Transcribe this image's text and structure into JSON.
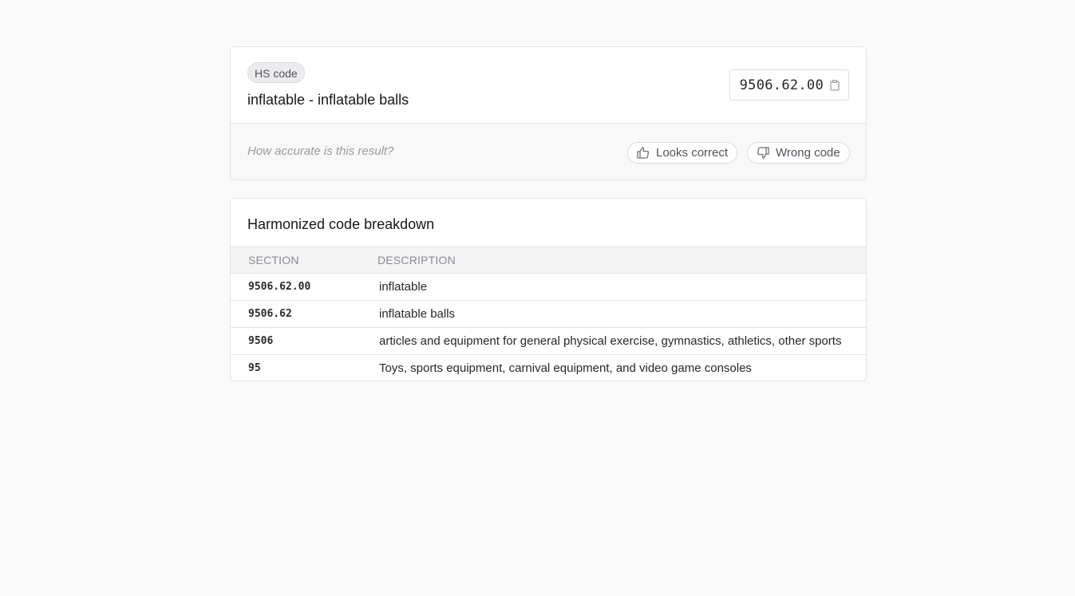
{
  "result": {
    "badge": "HS code",
    "title": "inflatable - inflatable balls",
    "code": "9506.62.00",
    "copy_icon": "clipboard-icon",
    "feedback": {
      "prompt": "How accurate is this result?",
      "positive_label": "Looks correct",
      "positive_icon": "thumbs-up-icon",
      "negative_label": "Wrong code",
      "negative_icon": "thumbs-down-icon"
    }
  },
  "breakdown": {
    "title": "Harmonized code breakdown",
    "columns": [
      "SECTION",
      "DESCRIPTION"
    ],
    "rows": [
      {
        "section": "9506.62.00",
        "description": "inflatable"
      },
      {
        "section": "9506.62",
        "description": "inflatable balls"
      },
      {
        "section": "9506",
        "description": "articles and equipment for general physical exercise, gymnastics, athletics, other sports"
      },
      {
        "section": "95",
        "description": "Toys, sports equipment, carnival equipment, and video game consoles"
      }
    ]
  },
  "colors": {
    "page_background": "#fafafa",
    "card_border": "#e4e4e7",
    "muted_text": "#9a9aa2"
  }
}
